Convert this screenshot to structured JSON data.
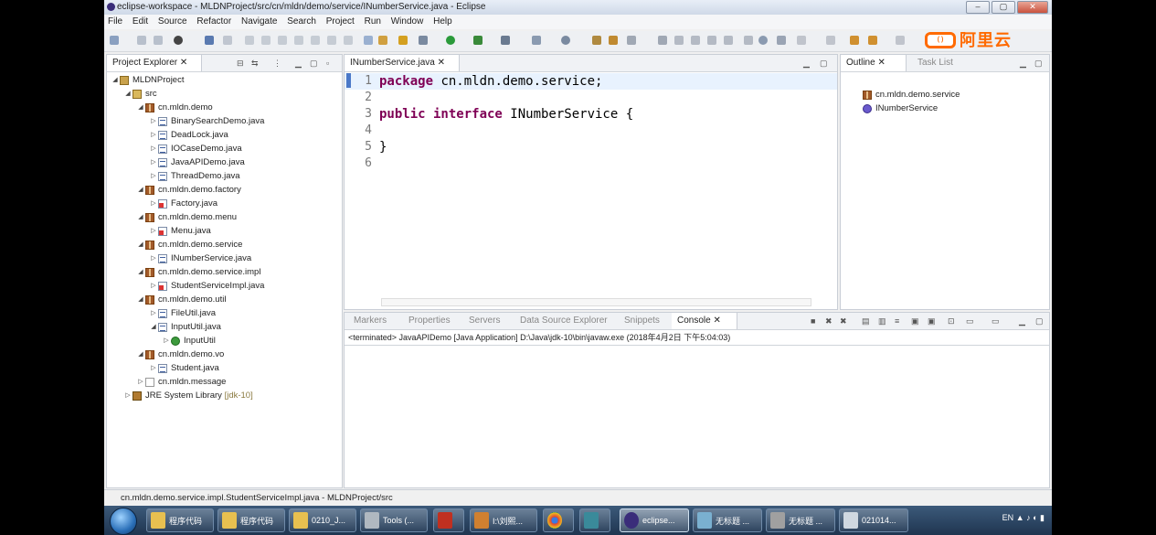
{
  "window": {
    "title": "eclipse-workspace - MLDNProject/src/cn/mldn/demo/service/INumberService.java - Eclipse",
    "minimize_icon": "minimize-icon",
    "maximize_icon": "maximize-icon",
    "close_icon": "close-icon"
  },
  "menu": [
    "File",
    "Edit",
    "Source",
    "Refactor",
    "Navigate",
    "Search",
    "Project",
    "Run",
    "Window",
    "Help"
  ],
  "watermark": "阿里云",
  "explorer": {
    "tab_label": "Project Explorer",
    "items": [
      {
        "label": "MLDNProject"
      },
      {
        "label": "src"
      },
      {
        "label": "cn.mldn.demo"
      },
      {
        "label": "BinarySearchDemo.java"
      },
      {
        "label": "DeadLock.java"
      },
      {
        "label": "IOCaseDemo.java"
      },
      {
        "label": "JavaAPIDemo.java"
      },
      {
        "label": "ThreadDemo.java"
      },
      {
        "label": "cn.mldn.demo.factory"
      },
      {
        "label": "Factory.java"
      },
      {
        "label": "cn.mldn.demo.menu"
      },
      {
        "label": "Menu.java"
      },
      {
        "label": "cn.mldn.demo.service"
      },
      {
        "label": "INumberService.java"
      },
      {
        "label": "cn.mldn.demo.service.impl"
      },
      {
        "label": "StudentServiceImpl.java"
      },
      {
        "label": "cn.mldn.demo.util"
      },
      {
        "label": "FileUtil.java"
      },
      {
        "label": "InputUtil.java"
      },
      {
        "label": "InputUtil"
      },
      {
        "label": "cn.mldn.demo.vo"
      },
      {
        "label": "Student.java"
      },
      {
        "label": "cn.mldn.message"
      },
      {
        "label": "JRE System Library",
        "suffix": "[jdk-10]"
      }
    ]
  },
  "editor": {
    "tab_label": "INumberService.java",
    "lines": [
      {
        "n": "1",
        "kw": "package",
        "rest": " cn.mldn.demo.service;"
      },
      {
        "n": "2",
        "kw": "",
        "rest": ""
      },
      {
        "n": "3",
        "kw": "public interface",
        "rest": " INumberService {"
      },
      {
        "n": "4",
        "kw": "",
        "rest": ""
      },
      {
        "n": "5",
        "kw": "",
        "rest": "}"
      },
      {
        "n": "6",
        "kw": "",
        "rest": ""
      }
    ]
  },
  "outline": {
    "tab_label": "Outline",
    "second_tab": "Task List",
    "items": [
      "cn.mldn.demo.service",
      "INumberService"
    ]
  },
  "console": {
    "tabs": [
      "Markers",
      "Properties",
      "Servers",
      "Data Source Explorer",
      "Snippets",
      "Console"
    ],
    "header": "<terminated> JavaAPIDemo [Java Application] D:\\Java\\jdk-10\\bin\\javaw.exe (2018年4月2日 下午5:04:03)"
  },
  "status": {
    "text": "cn.mldn.demo.service.impl.StudentServiceImpl.java - MLDNProject/src"
  },
  "taskbar": {
    "buttons": [
      "程序代码",
      "程序代码",
      "0210_J...",
      "Tools (...",
      "",
      "I:\\刘熙...",
      "",
      "",
      "eclipse...",
      "无标题 ...",
      "无标题 ...",
      "021014..."
    ],
    "tray": "EN"
  }
}
